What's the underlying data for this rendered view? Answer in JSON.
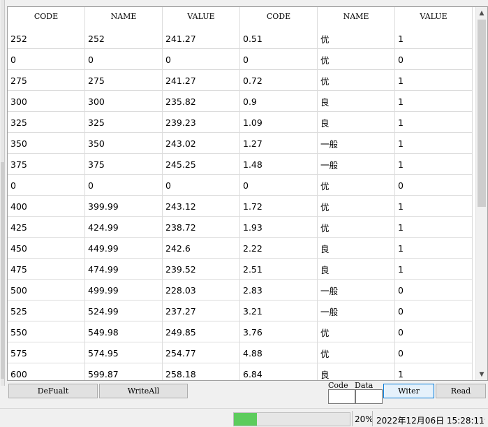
{
  "table": {
    "headers": [
      "CODE",
      "NAME",
      "VALUE",
      "CODE",
      "NAME",
      "VALUE"
    ],
    "rows": [
      [
        "252",
        "252",
        "241.27",
        "0.51",
        "优",
        "1"
      ],
      [
        "0",
        "0",
        "0",
        "0",
        "优",
        "0"
      ],
      [
        "275",
        "275",
        "241.27",
        "0.72",
        "优",
        "1"
      ],
      [
        "300",
        "300",
        "235.82",
        "0.9",
        "良",
        "1"
      ],
      [
        "325",
        "325",
        "239.23",
        "1.09",
        "良",
        "1"
      ],
      [
        "350",
        "350",
        "243.02",
        "1.27",
        "一般",
        "1"
      ],
      [
        "375",
        "375",
        "245.25",
        "1.48",
        "一般",
        "1"
      ],
      [
        "0",
        "0",
        "0",
        "0",
        "优",
        "0"
      ],
      [
        "400",
        "399.99",
        "243.12",
        "1.72",
        "优",
        "1"
      ],
      [
        "425",
        "424.99",
        "238.72",
        "1.93",
        "优",
        "1"
      ],
      [
        "450",
        "449.99",
        "242.6",
        "2.22",
        "良",
        "1"
      ],
      [
        "475",
        "474.99",
        "239.52",
        "2.51",
        "良",
        "1"
      ],
      [
        "500",
        "499.99",
        "228.03",
        "2.83",
        "一般",
        "0"
      ],
      [
        "525",
        "524.99",
        "237.27",
        "3.21",
        "一般",
        "0"
      ],
      [
        "550",
        "549.98",
        "249.85",
        "3.76",
        "优",
        "0"
      ],
      [
        "575",
        "574.95",
        "254.77",
        "4.88",
        "优",
        "0"
      ],
      [
        "600",
        "599.87",
        "258.18",
        "6.84",
        "良",
        "1"
      ]
    ]
  },
  "toolbar": {
    "default_label": "DeFualt",
    "write_all_label": "WriteAll",
    "code_label": "Code",
    "data_label": "Data",
    "code_value": "",
    "data_value": "",
    "writer_label": "Witer",
    "read_label": "Read"
  },
  "status": {
    "progress_percent": 20,
    "progress_text": "20%",
    "datetime": "2022年12月06日 15:28:11"
  },
  "colors": {
    "progress": "#5ccc5c",
    "accent": "#0078d7"
  }
}
